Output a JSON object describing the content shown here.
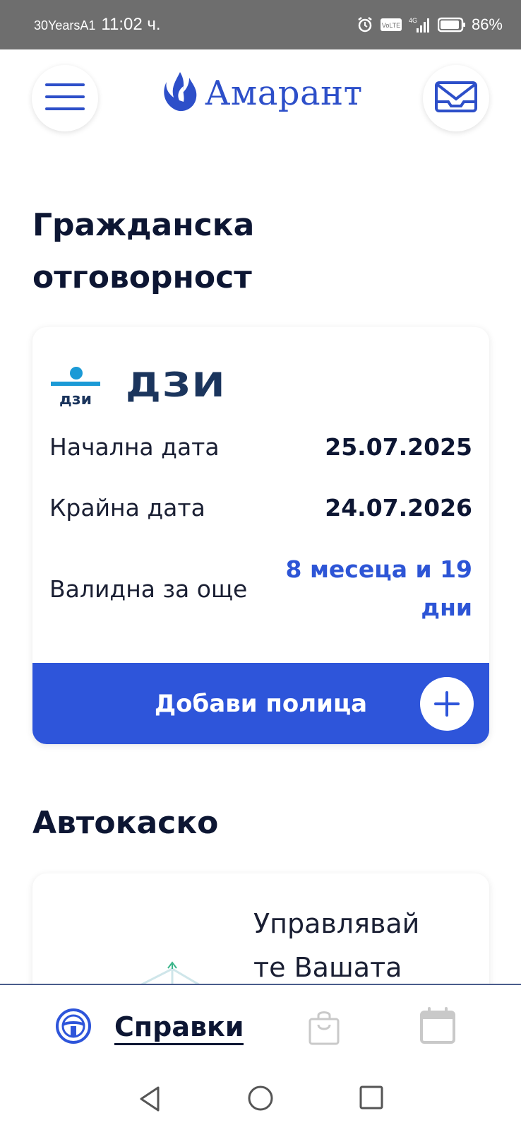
{
  "status_bar": {
    "carrier": "30YearsA1",
    "time": "11:02 ч.",
    "battery": "86%",
    "icons": [
      "alarm-icon",
      "volte-icon",
      "signal-4g-icon",
      "battery-icon"
    ]
  },
  "header": {
    "logo_text": "Амарант",
    "icons": [
      "menu-icon",
      "mail-icon",
      "logo-flame-icon"
    ]
  },
  "sections": {
    "liability_title_line1": "Гражданска",
    "liability_title_line2": "отговорност",
    "casco_title": "Автокаско"
  },
  "policy_card": {
    "insurer": "ДЗИ",
    "insurer_mark_text": "дзи",
    "start_label": "Начална дата",
    "start_value": "25.07.2025",
    "end_label": "Крайна дата",
    "end_value": "24.07.2026",
    "valid_label": "Валидна за още",
    "valid_value_line1": "8 месеца и 19",
    "valid_value_line2": "дни",
    "add_button_label": "Добави полица"
  },
  "casco_card": {
    "promo_line1": "Управлявай",
    "promo_line2": "те Вашата"
  },
  "bottom_nav": {
    "active_label": "Справки",
    "icons": [
      "steering-wheel-icon",
      "shopping-bag-icon",
      "calendar-icon"
    ]
  },
  "system_nav": {
    "icons": [
      "back-icon",
      "home-icon",
      "recents-icon"
    ]
  },
  "colors": {
    "accent": "#2e55da",
    "text_dark": "#0d1633",
    "status_bar": "#6e6e6e"
  }
}
